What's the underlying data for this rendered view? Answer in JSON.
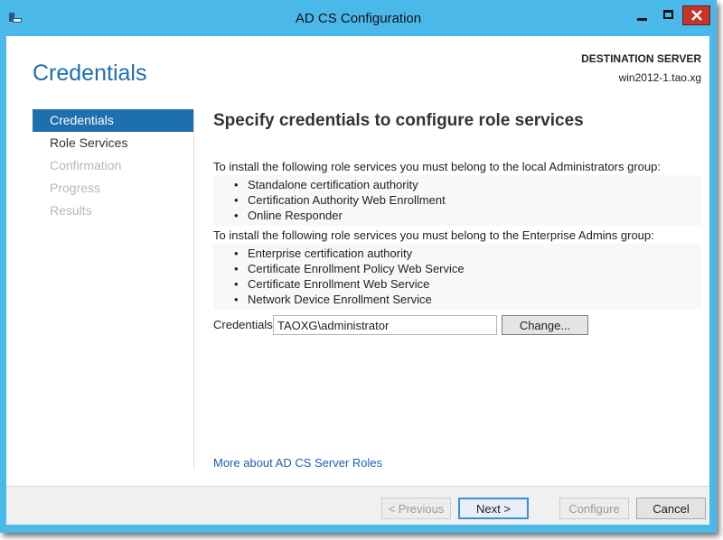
{
  "window": {
    "title": "AD CS Configuration"
  },
  "header": {
    "title": "Credentials",
    "destination_label": "DESTINATION SERVER",
    "destination_server": "win2012-1.tao.xg"
  },
  "nav": {
    "items": [
      {
        "label": "Credentials",
        "state": "active"
      },
      {
        "label": "Role Services",
        "state": "enabled"
      },
      {
        "label": "Confirmation",
        "state": "disabled"
      },
      {
        "label": "Progress",
        "state": "disabled"
      },
      {
        "label": "Results",
        "state": "disabled"
      }
    ]
  },
  "content": {
    "title": "Specify credentials to configure role services",
    "local_admins_text": "To install the following role services you must belong to the local Administrators group:",
    "local_admins_roles": [
      "Standalone certification authority",
      "Certification Authority Web Enrollment",
      "Online Responder"
    ],
    "enterprise_admins_text": "To install the following role services you must belong to the Enterprise Admins group:",
    "enterprise_admins_roles": [
      "Enterprise certification authority",
      "Certificate Enrollment Policy Web Service",
      "Certificate Enrollment Web Service",
      "Network Device Enrollment Service"
    ],
    "credentials_label": "Credentials:",
    "credentials_value": "TAOXG\\administrator",
    "change_label": "Change...",
    "more_link": "More about AD CS Server Roles"
  },
  "footer": {
    "previous_label": "< Previous",
    "next_label": "Next >",
    "configure_label": "Configure",
    "cancel_label": "Cancel"
  },
  "colors": {
    "window_frame": "#4bb8ea",
    "accent": "#1e6fae",
    "close_button": "#c2352b",
    "link": "#1a62b0"
  },
  "icons": [
    "server-manager-icon",
    "minimize-icon",
    "maximize-icon",
    "close-icon"
  ]
}
